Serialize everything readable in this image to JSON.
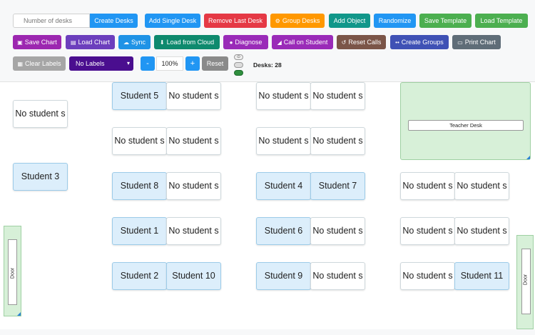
{
  "toolbar": {
    "desk_count_placeholder": "Number of desks",
    "create_desks": "Create Desks",
    "add_single_desk": "Add Single Desk",
    "remove_last_desk": "Remove Last Desk",
    "group_desks": "Group Desks",
    "add_object": "Add Object",
    "randomize": "Randomize",
    "save_template": "Save Template",
    "load_template": "Load Template",
    "save_chart": "Save Chart",
    "load_chart": "Load Chart",
    "sync": "Sync",
    "load_from_cloud": "Load from Cloud",
    "diagnose": "Diagnose",
    "call_on_student": "Call on Student",
    "reset_calls": "Reset Calls",
    "create_groups": "Create Groups",
    "print_chart": "Print Chart",
    "clear_labels": "Clear Labels",
    "label_select": "No Labels",
    "zoom_out": "-",
    "zoom_level": "100%",
    "zoom_in": "+",
    "zoom_reset": "Reset",
    "desks_count": "Desks: 28"
  },
  "room": {
    "teacher_desk_label": "Teacher Desk",
    "door_left_label": "Door",
    "door_right_label": "Door"
  },
  "desks": [
    "No student s",
    "Student 3",
    "Student 5",
    "No student s",
    "No student s",
    "No student s",
    "Student 8",
    "No student s",
    "Student 1",
    "No student s",
    "Student 2",
    "Student 10",
    "No student s",
    "No student s",
    "No student s",
    "No student s",
    "Student 4",
    "Student 7",
    "Student 6",
    "No student s",
    "Student 9",
    "No student s",
    "No student s",
    "No student s",
    "No student s",
    "No student s",
    "No student s",
    "Student 11"
  ],
  "colors": {
    "occupied_desk": "#dceefb",
    "empty_desk": "#ffffff",
    "zone_green": "#d7f0d8"
  }
}
